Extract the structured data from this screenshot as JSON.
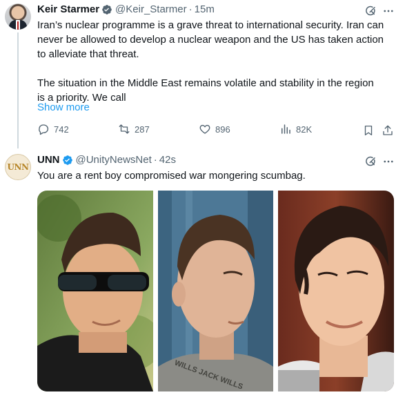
{
  "tweet1": {
    "name": "Keir Starmer",
    "handle": "@Keir_Starmer",
    "separator": "·",
    "time": "15m",
    "text_p1_l1": "Iran’s nuclear programme is a grave threat to international security. Iran can",
    "text_p1_l2": "never be allowed to develop a nuclear weapon and the US has taken action",
    "text_p1_l3": "to alleviate that threat.",
    "text_p2_l1": "The situation in the Middle East remains volatile and stability in the region",
    "text_p2_l2": "is a priority. We call",
    "show_more": "Show more",
    "replies": "742",
    "reposts": "287",
    "likes": "896",
    "views": "82K"
  },
  "tweet2": {
    "name": "UNN",
    "avatar_text": "UNN",
    "handle": "@UnityNewsNet",
    "separator": "·",
    "time": "42s",
    "text": "You are a rent boy compromised war mongering scumbag.",
    "shirt_text": "WILLS JACK WILLS"
  },
  "colors": {
    "accent": "#1d9bf0",
    "secondary_text": "#536471",
    "thread_line": "#cfd9de"
  }
}
